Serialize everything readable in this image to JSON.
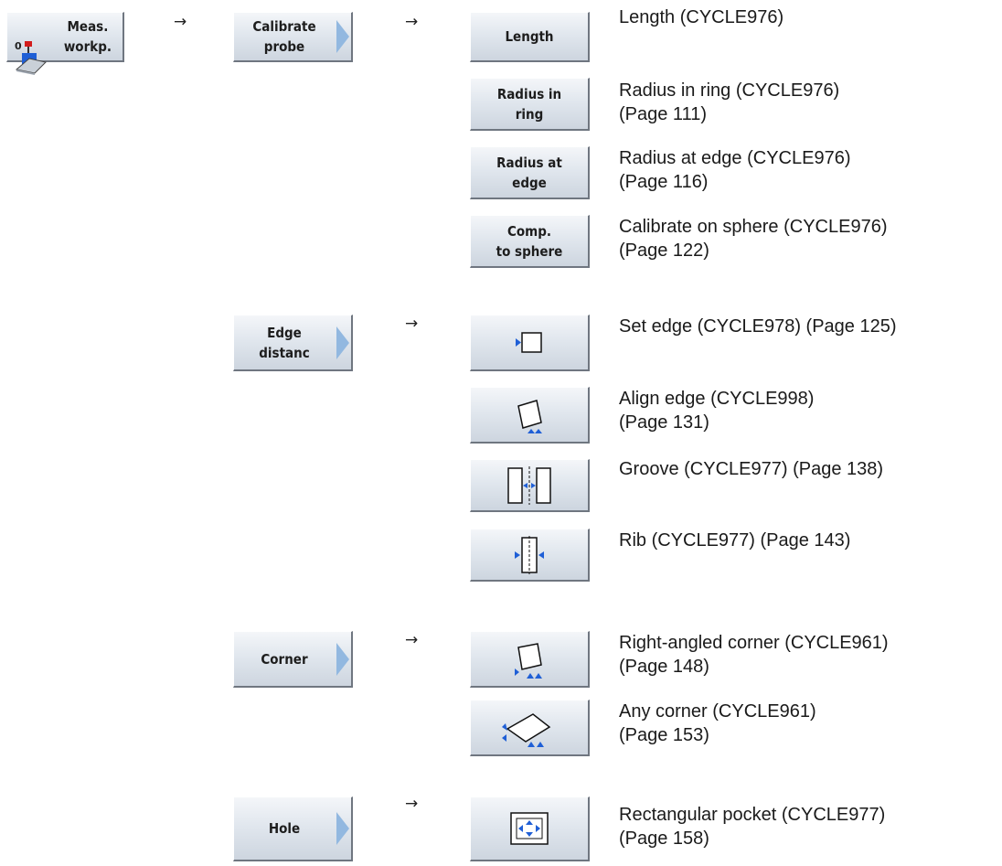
{
  "arrow": "→",
  "buttons": {
    "meas_workp": "Meas.\nworkp.",
    "calibrate_probe": "Calibrate\nprobe",
    "length": "Length",
    "radius_in_ring": "Radius in\nring",
    "radius_at_edge": "Radius at\nedge",
    "comp_to_sphere": "Comp.\nto sphere",
    "edge_distanc": "Edge\ndistanc",
    "corner": "Corner",
    "hole": "Hole"
  },
  "descriptions": {
    "length": "Length (CYCLE976)",
    "radius_in_ring": "Radius in ring (CYCLE976)\n(Page 111)",
    "radius_at_edge": "Radius at edge (CYCLE976)\n(Page 116)",
    "calibrate_on_sphere": "Calibrate on sphere (CYCLE976)\n(Page 122)",
    "set_edge": "Set edge (CYCLE978) (Page 125)",
    "align_edge": "Align edge (CYCLE998)\n(Page 131)",
    "groove": "Groove (CYCLE977) (Page 138)",
    "rib": "Rib (CYCLE977) (Page 143)",
    "right_angled_corner": "Right-angled corner (CYCLE961)\n(Page 148)",
    "any_corner": "Any corner (CYCLE961)\n(Page 153)",
    "rectangular_pocket": "Rectangular pocket (CYCLE977)\n(Page 158)"
  },
  "icons": {
    "meas_workp": "probe-workpiece-icon",
    "set_edge": "set-edge-icon",
    "align_edge": "align-edge-icon",
    "groove": "groove-icon",
    "rib": "rib-icon",
    "right_angled_corner": "right-angled-corner-icon",
    "any_corner": "any-corner-icon",
    "rectangular_pocket": "rectangular-pocket-icon"
  },
  "colors": {
    "button_arrow": "#92b8e0",
    "icon_marker": "#1f5fd6"
  }
}
